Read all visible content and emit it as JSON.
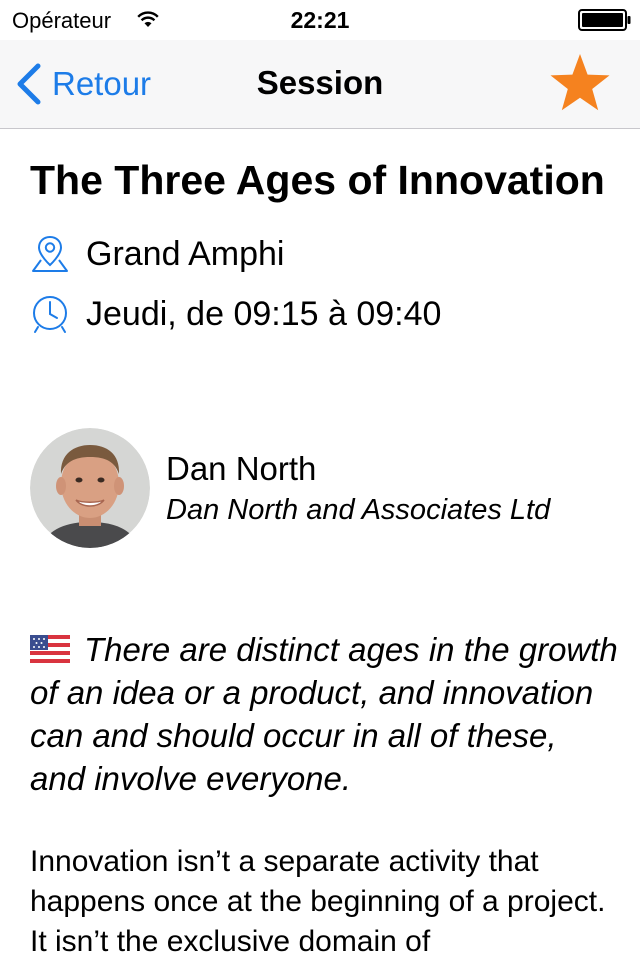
{
  "status_bar": {
    "carrier": "Opérateur",
    "time": "22:21"
  },
  "nav": {
    "back_label": "Retour",
    "title": "Session",
    "favorite_color": "#f5821f",
    "accent_color": "#1d7ce8"
  },
  "session": {
    "title": "The Three Ages of Innovation",
    "location": "Grand Amphi",
    "schedule": "Jeudi, de 09:15 à 09:40"
  },
  "speaker": {
    "name": "Dan North",
    "company": "Dan North and Associates Ltd"
  },
  "summary": {
    "language_flag": "us-flag-icon",
    "text": "There are distinct ages in the growth of an idea or a product, and innovation can and should occur in all of these, and involve everyone."
  },
  "description": {
    "text": "Innovation isn’t a separate activity that happens once at the beginning of a project. It isn’t the exclusive domain of"
  }
}
